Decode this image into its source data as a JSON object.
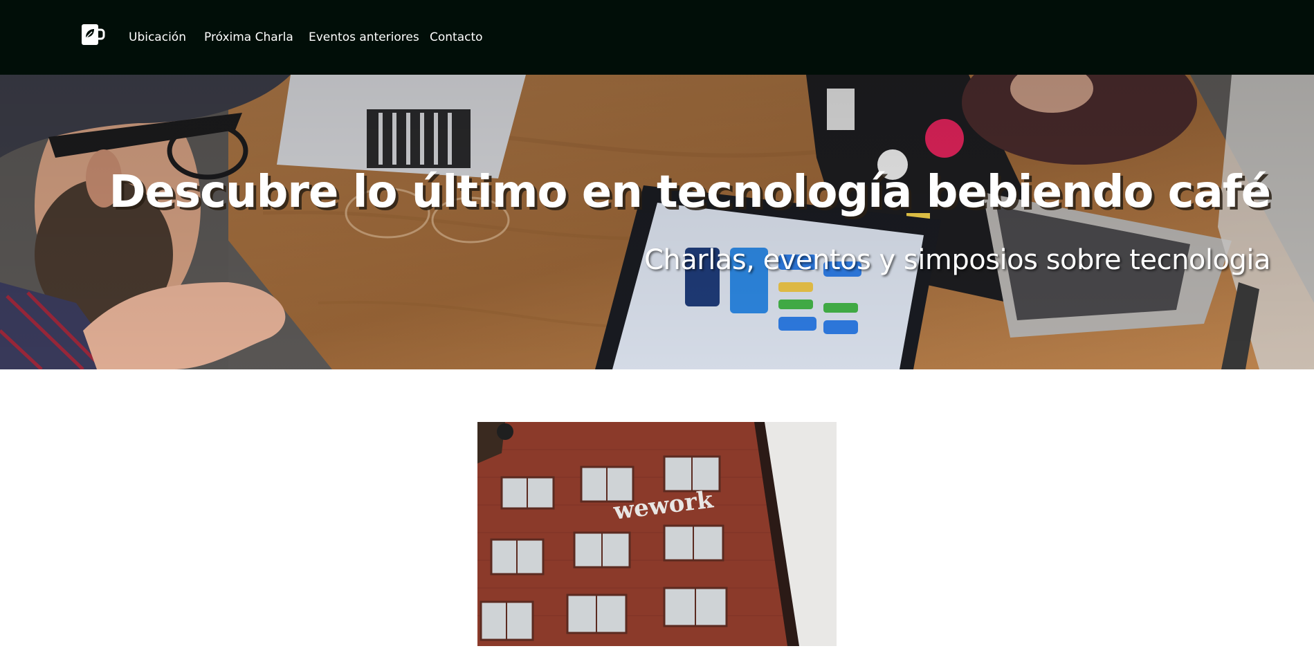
{
  "nav": {
    "logo_icon": "coffee-mug-leaf-icon",
    "links": [
      {
        "label": "Ubicación"
      },
      {
        "label": "Próxima Charla"
      },
      {
        "label": "Eventos anteriores"
      },
      {
        "label": "Contacto"
      }
    ]
  },
  "hero": {
    "title": "Descubre lo último en tecnología bebiendo café",
    "subtitle": "Charlas, eventos y simposios sobre tecnologia"
  },
  "content": {
    "building_sign": "wework"
  },
  "colors": {
    "navbar_bg": "#010e08",
    "text_on_dark": "#ffffff",
    "brick": "#8b3a2a",
    "table_wood": "#a8703f"
  }
}
